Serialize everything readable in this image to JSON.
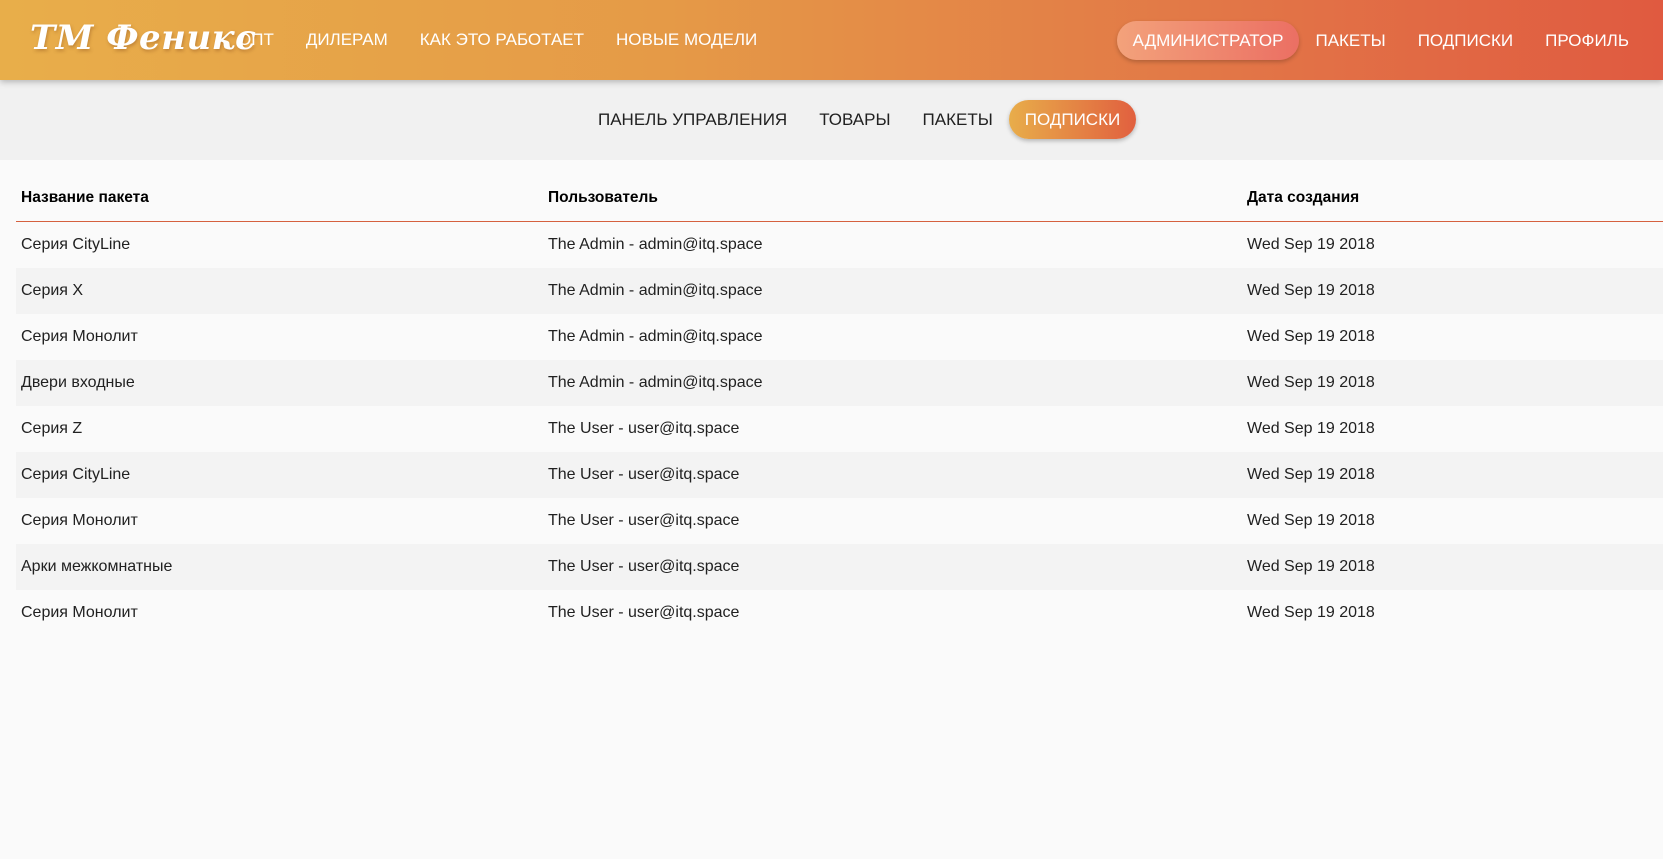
{
  "header": {
    "brand": "ТМ Феникс",
    "nav_left": [
      {
        "label": "ОПТ"
      },
      {
        "label": "ДИЛЕРАМ"
      },
      {
        "label": "КАК ЭТО РАБОТАЕТ"
      },
      {
        "label": "НОВЫЕ МОДЕЛИ"
      }
    ],
    "nav_right": [
      {
        "label": "АДМИНИСТРАТОР",
        "active": true
      },
      {
        "label": "ПАКЕТЫ"
      },
      {
        "label": "ПОДПИСКИ"
      },
      {
        "label": "ПРОФИЛЬ"
      }
    ]
  },
  "subnav": {
    "items": [
      {
        "label": "ПАНЕЛЬ УПРАВЛЕНИЯ"
      },
      {
        "label": "ТОВАРЫ"
      },
      {
        "label": "ПАКЕТЫ"
      },
      {
        "label": "ПОДПИСКИ",
        "active": true
      }
    ]
  },
  "table": {
    "columns": [
      "Название пакета",
      "Пользователь",
      "Дата создания"
    ],
    "rows": [
      [
        "Серия CityLine",
        "The Admin - admin@itq.space",
        "Wed Sep 19 2018"
      ],
      [
        "Серия X",
        "The Admin - admin@itq.space",
        "Wed Sep 19 2018"
      ],
      [
        "Серия Монолит",
        "The Admin - admin@itq.space",
        "Wed Sep 19 2018"
      ],
      [
        "Двери входные",
        "The Admin - admin@itq.space",
        "Wed Sep 19 2018"
      ],
      [
        "Серия Z",
        "The User - user@itq.space",
        "Wed Sep 19 2018"
      ],
      [
        "Серия CityLine",
        "The User - user@itq.space",
        "Wed Sep 19 2018"
      ],
      [
        "Серия Монолит",
        "The User - user@itq.space",
        "Wed Sep 19 2018"
      ],
      [
        "Арки межкомнатные",
        "The User - user@itq.space",
        "Wed Sep 19 2018"
      ],
      [
        "Серия Монолит",
        "The User - user@itq.space",
        "Wed Sep 19 2018"
      ]
    ]
  },
  "colors": {
    "header_gradient_start": "#e8ae4a",
    "header_gradient_end": "#e05a40",
    "accent_line": "#d5603f",
    "subnav_bg": "#f1f1f1"
  }
}
